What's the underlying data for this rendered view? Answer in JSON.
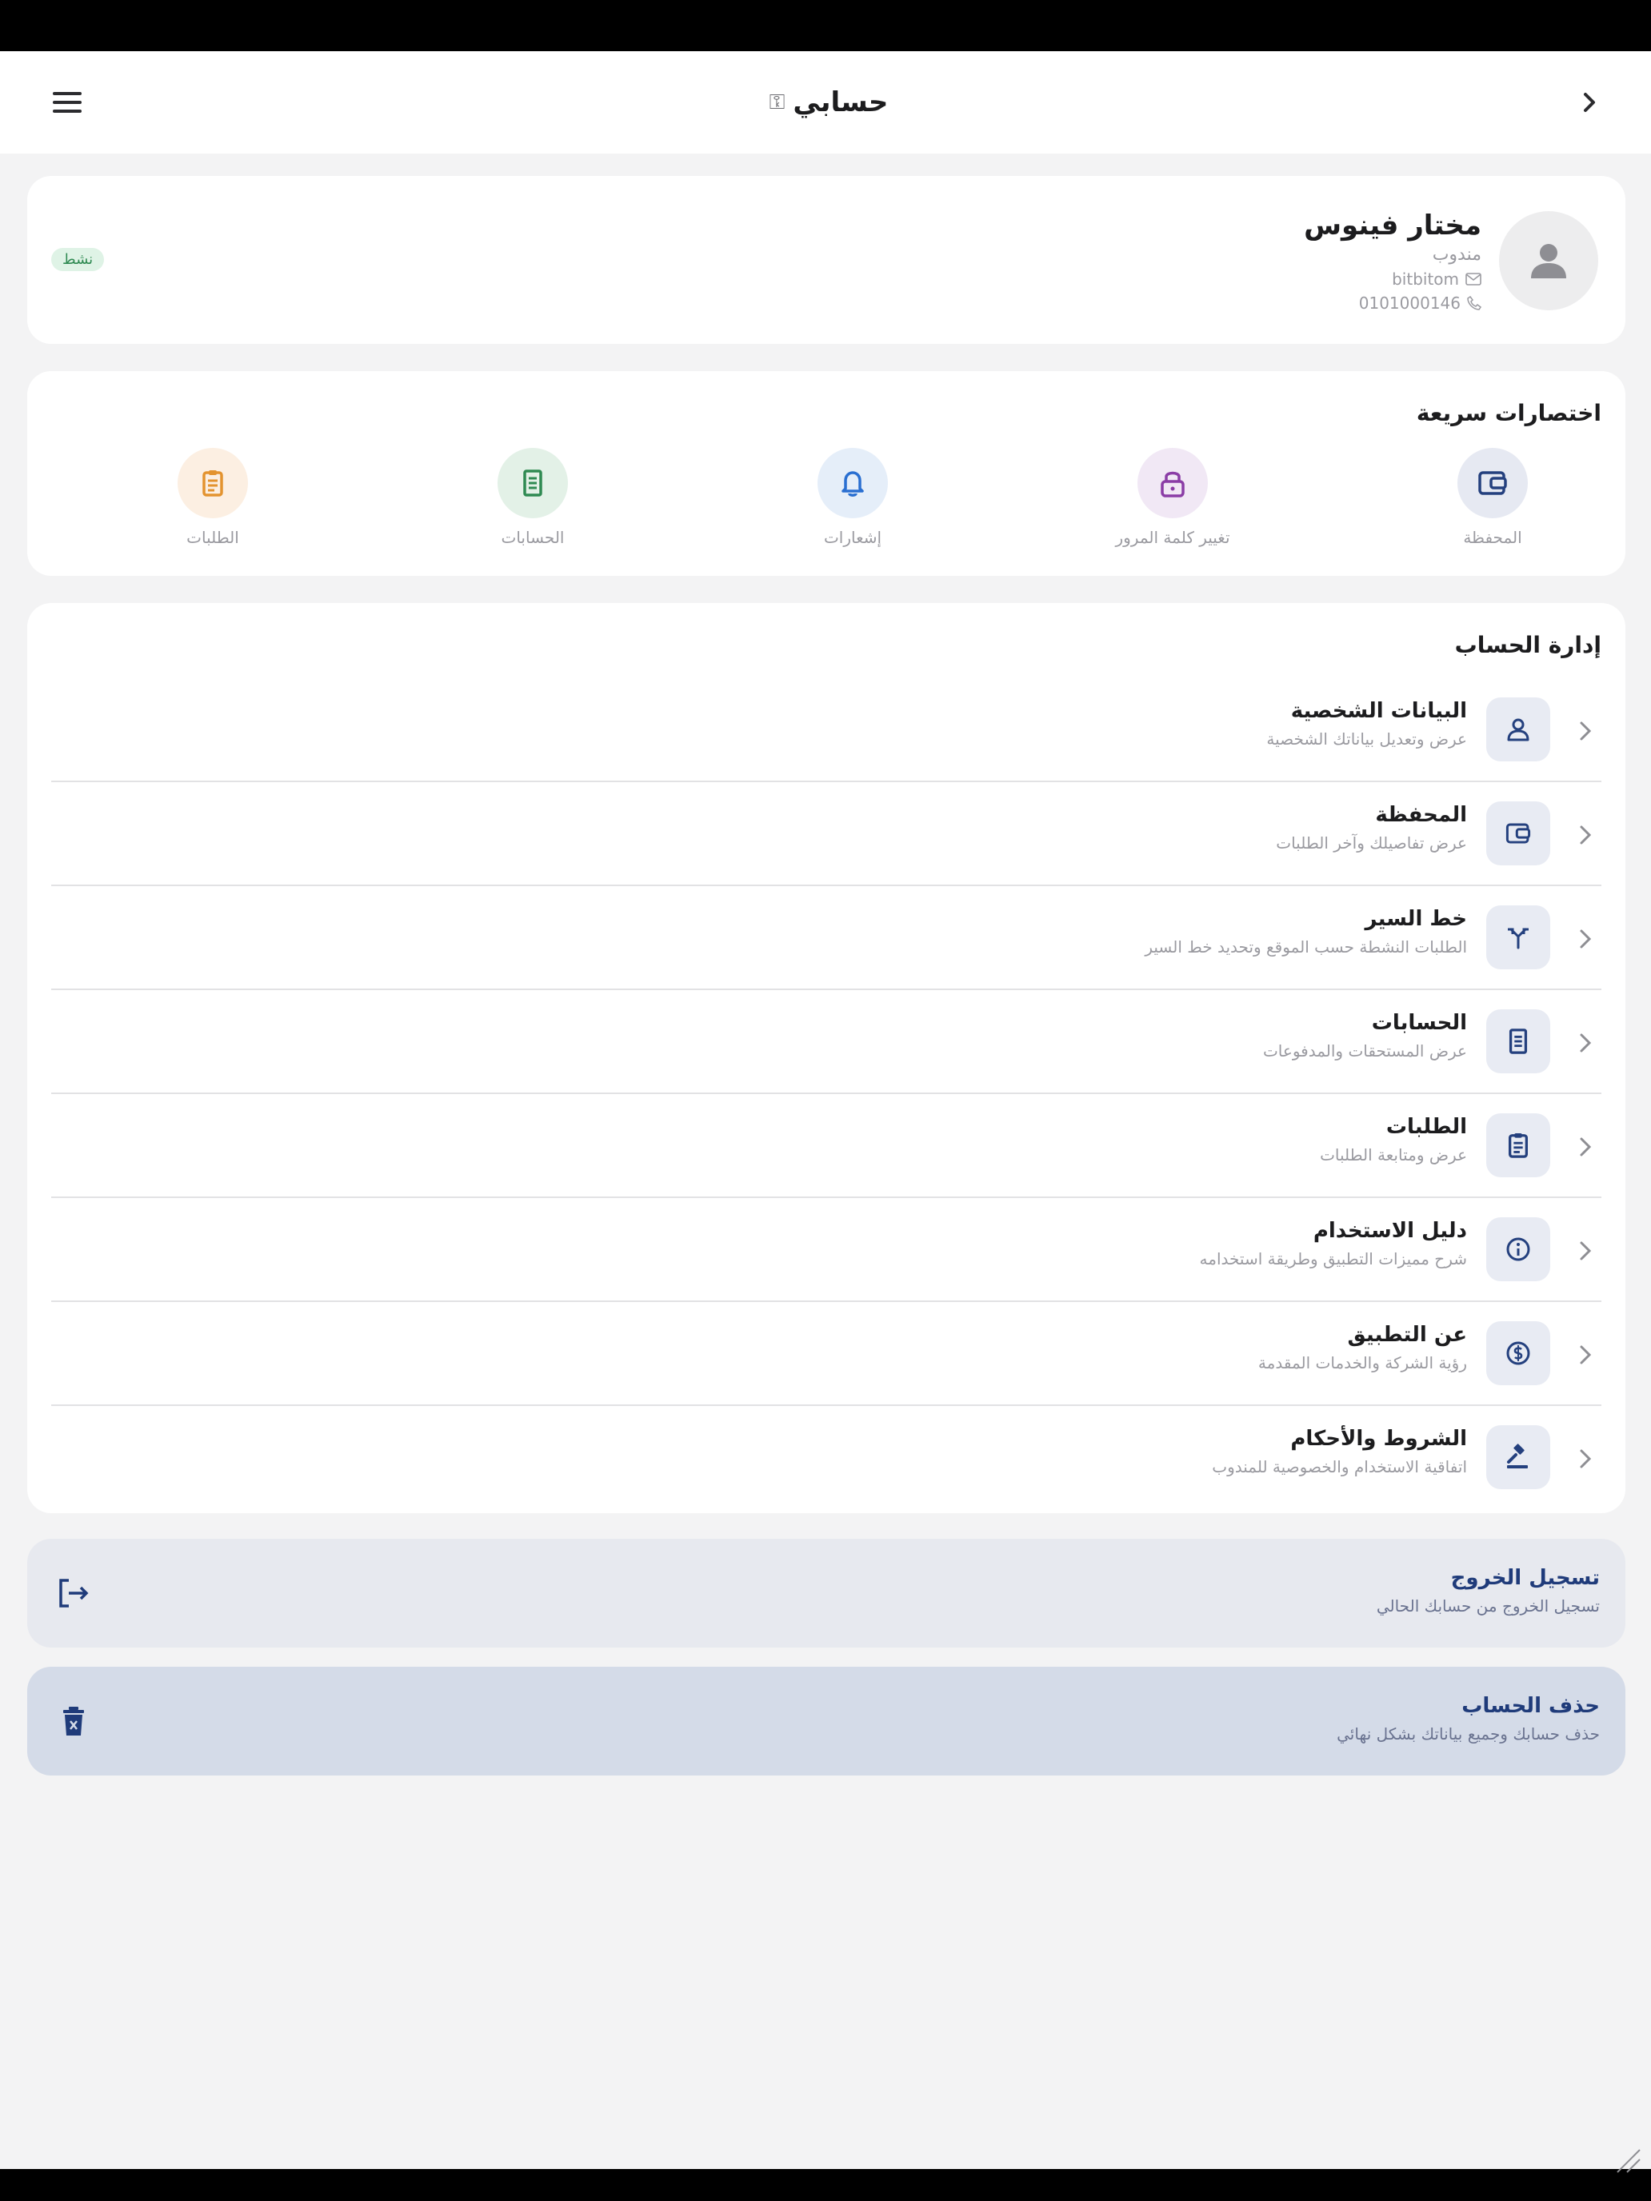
{
  "header": {
    "title": "حسابي",
    "title_glyph": "⚿"
  },
  "profile": {
    "name": "مختار فينوس",
    "role": "مندوب",
    "email": "bitbitom",
    "phone": "0101000146",
    "badge": "نشط"
  },
  "shortcuts": {
    "title": "اختصارات سريعة",
    "items": [
      {
        "label": "المحفظة",
        "icon": "wallet-icon",
        "bg": "#e6e9f2",
        "fg": "#24407e"
      },
      {
        "label": "تغيير كلمة المرور",
        "icon": "lock-icon",
        "bg": "#f1e8f5",
        "fg": "#8b3da6"
      },
      {
        "label": "إشعارات",
        "icon": "bell-icon",
        "bg": "#e5eef9",
        "fg": "#2a6fd1"
      },
      {
        "label": "الحسابات",
        "icon": "receipt-icon",
        "bg": "#e3f1e7",
        "fg": "#2f8a52"
      },
      {
        "label": "الطلبات",
        "icon": "clipboard-icon",
        "bg": "#fcefe2",
        "fg": "#e3932f"
      }
    ]
  },
  "manage": {
    "title": "إدارة الحساب",
    "items": [
      {
        "title": "البيانات الشخصية",
        "subtitle": "عرض وتعديل بياناتك الشخصية",
        "icon": "person-icon"
      },
      {
        "title": "المحفظة",
        "subtitle": "عرض تفاصيلك وآخر الطلبات",
        "icon": "wallet-icon"
      },
      {
        "title": "خط السير",
        "subtitle": "الطلبات النشطة حسب الموقع وتحديد خط السير",
        "icon": "route-icon"
      },
      {
        "title": "الحسابات",
        "subtitle": "عرض المستحقات والمدفوعات",
        "icon": "receipt-icon"
      },
      {
        "title": "الطلبات",
        "subtitle": "عرض ومتابعة الطلبات",
        "icon": "clipboard-icon"
      },
      {
        "title": "دليل الاستخدام",
        "subtitle": "شرح مميزات التطبيق وطريقة استخدامه",
        "icon": "info-icon"
      },
      {
        "title": "عن التطبيق",
        "subtitle": "رؤية الشركة والخدمات المقدمة",
        "icon": "coin-icon"
      },
      {
        "title": "الشروط والأحكام",
        "subtitle": "اتفاقية الاستخدام والخصوصية للمندوب",
        "icon": "gavel-icon"
      }
    ]
  },
  "logout": {
    "title": "تسجيل الخروج",
    "subtitle": "تسجيل الخروج من حسابك الحالي"
  },
  "delete_account": {
    "title": "حذف الحساب",
    "subtitle": "حذف حسابك وجميع بياناتك بشكل نهائي"
  },
  "colors": {
    "primary": "#1f3b7a",
    "background": "#f3f3f4",
    "icon_box": "#e8ebf3"
  }
}
